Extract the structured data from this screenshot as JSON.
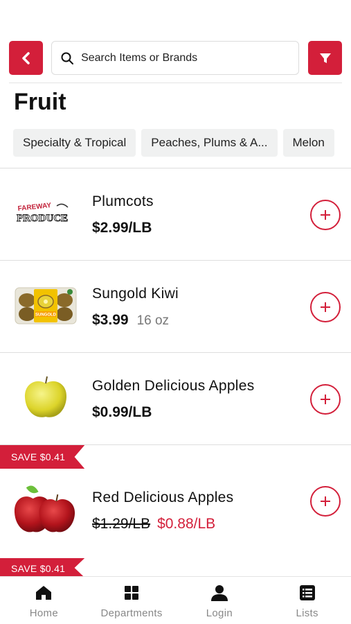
{
  "header": {
    "back_icon": "chevron-left-icon",
    "search_placeholder": "Search Items or Brands",
    "filter_icon": "filter-icon",
    "accent_color": "#d31f3a"
  },
  "page": {
    "title": "Fruit"
  },
  "categories": [
    {
      "label": "Specialty & Tropical"
    },
    {
      "label": "Peaches, Plums & A..."
    },
    {
      "label": "Melon"
    }
  ],
  "products": [
    {
      "name": "Plumcots",
      "price": "$2.99/LB",
      "size": "",
      "brand_text_1": "FAREWAY",
      "brand_text_2": "PRODUCE"
    },
    {
      "name": "Sungold Kiwi",
      "price": "$3.99",
      "size": "16 oz",
      "pack_label": "SUNGOLD"
    },
    {
      "name": "Golden Delicious Apples",
      "price": "$0.99/LB",
      "size": ""
    },
    {
      "name": "Red Delicious Apples",
      "sale_badge": "SAVE $0.41",
      "old_price": "$1.29/LB",
      "sale_price": "$0.88/LB"
    }
  ],
  "next_sale_badge": "SAVE $0.41",
  "bottom_nav": [
    {
      "label": "Home",
      "icon": "home-icon"
    },
    {
      "label": "Departments",
      "icon": "grid-icon"
    },
    {
      "label": "Login",
      "icon": "person-icon"
    },
    {
      "label": "Lists",
      "icon": "list-icon"
    }
  ]
}
